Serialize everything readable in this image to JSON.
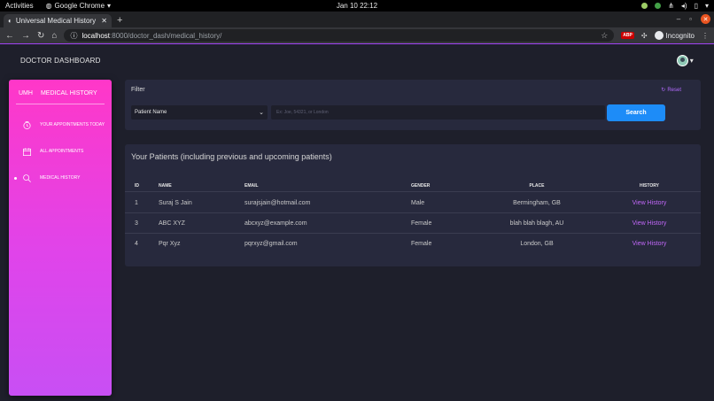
{
  "os": {
    "activities": "Activities",
    "app_name": "Google Chrome",
    "clock": "Jan 10  22:12"
  },
  "browser": {
    "tab_title": "Universal Medical History",
    "url_host": "localhost",
    "url_path": ":8000/doctor_dash/medical_history/",
    "abp_label": "ABP",
    "incognito_label": "Incognito",
    "accent": "#a142f4"
  },
  "header": {
    "title": "DOCTOR DASHBOARD"
  },
  "sidebar": {
    "brand_short": "UMH",
    "brand_full": "MEDICAL HISTORY",
    "items": [
      {
        "label": "YOUR APPOINTMENTS TODAY",
        "icon": "clock-icon",
        "active": false
      },
      {
        "label": "ALL APPOINTMENTS",
        "icon": "calendar-icon",
        "active": false
      },
      {
        "label": "MEDICAL HISTORY",
        "icon": "search-icon",
        "active": true
      }
    ],
    "gradient": [
      "#ff37c8",
      "#c84ff4"
    ]
  },
  "filter": {
    "title": "Filter",
    "reset_label": "Reset",
    "select_value": "Patient Name",
    "search_placeholder": "Ex: Joe, 54321, or London",
    "search_button": "Search",
    "button_color": "#1d8cf8"
  },
  "patients": {
    "title": "Your Patients (including previous and upcoming patients)",
    "columns": [
      "ID",
      "NAME",
      "EMAIL",
      "GENDER",
      "PLACE",
      "HISTORY"
    ],
    "rows": [
      {
        "id": "1",
        "name": "Suraj S Jain",
        "email": "surajsjain@hotmail.com",
        "gender": "Male",
        "place": "Bermingham, GB",
        "history": "View History"
      },
      {
        "id": "3",
        "name": "ABC XYZ",
        "email": "abcxyz@example.com",
        "gender": "Female",
        "place": "blah blah blagh, AU",
        "history": "View History"
      },
      {
        "id": "4",
        "name": "Pqr Xyz",
        "email": "pqrxyz@gmail.com",
        "gender": "Female",
        "place": "London, GB",
        "history": "View History"
      }
    ]
  }
}
